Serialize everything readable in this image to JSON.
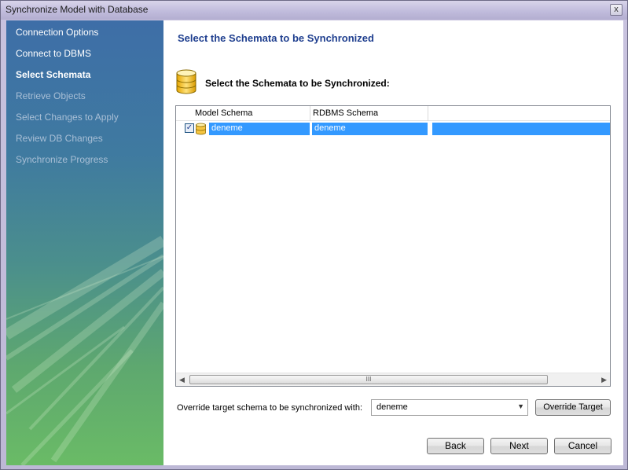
{
  "window": {
    "title": "Synchronize Model with Database",
    "close_glyph": "x"
  },
  "sidebar": {
    "items": [
      {
        "label": "Connection Options",
        "state": "done"
      },
      {
        "label": "Connect to DBMS",
        "state": "done"
      },
      {
        "label": "Select Schemata",
        "state": "current"
      },
      {
        "label": "Retrieve Objects",
        "state": "pending"
      },
      {
        "label": "Select Changes to Apply",
        "state": "pending"
      },
      {
        "label": "Review DB Changes",
        "state": "pending"
      },
      {
        "label": "Synchronize Progress",
        "state": "pending"
      }
    ]
  },
  "main": {
    "page_title": "Select the Schemata to be Synchronized",
    "section_label": "Select the Schemata to be Synchronized:",
    "section_icon": "database-icon",
    "table": {
      "columns": [
        "Model Schema",
        "RDBMS Schema"
      ],
      "rows": [
        {
          "checked": true,
          "check_glyph": "✓",
          "icon": "database-icon",
          "model_schema": "deneme",
          "rdbms_schema": "deneme"
        }
      ],
      "scroll_thumb_glyph": "III"
    },
    "override": {
      "label": "Override target schema to be synchronized with:",
      "selected": "deneme",
      "button": "Override Target"
    }
  },
  "buttons": {
    "back": "Back",
    "next": "Next",
    "cancel": "Cancel"
  },
  "colors": {
    "title_accent": "#1f3f8f",
    "selection": "#3399ff",
    "sidebar_top": "#3e6ea7",
    "sidebar_bottom": "#6abb66"
  }
}
